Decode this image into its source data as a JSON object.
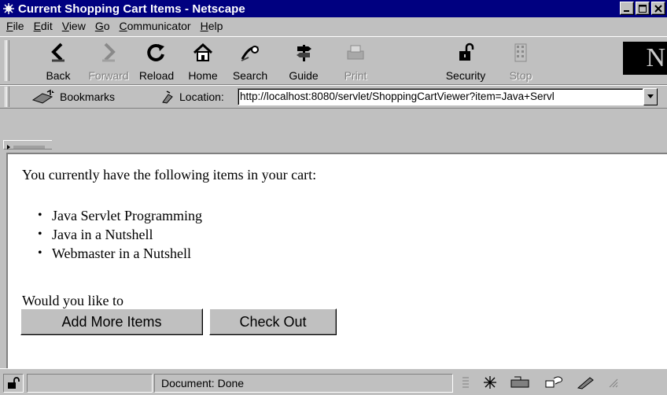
{
  "window": {
    "title": "Current Shopping Cart Items - Netscape"
  },
  "menubar": {
    "items": [
      {
        "ul": "F",
        "rest": "ile"
      },
      {
        "ul": "E",
        "rest": "dit"
      },
      {
        "ul": "V",
        "rest": "iew"
      },
      {
        "ul": "G",
        "rest": "o"
      },
      {
        "ul": "C",
        "rest": "ommunicator"
      },
      {
        "ul": "H",
        "rest": "elp"
      }
    ]
  },
  "toolbar": {
    "back": "Back",
    "forward": "Forward",
    "reload": "Reload",
    "home": "Home",
    "search": "Search",
    "guide": "Guide",
    "print": "Print",
    "security": "Security",
    "stop": "Stop",
    "logo": "N"
  },
  "location": {
    "bookmarks_label": "Bookmarks",
    "label": "Location:",
    "url": "http://localhost:8080/servlet/ShoppingCartViewer?item=Java+Servl"
  },
  "page": {
    "intro": "You currently have the following items in your cart:",
    "items": [
      "Java Servlet Programming",
      "Java in a Nutshell",
      "Webmaster in a Nutshell"
    ],
    "question": "Would you like to",
    "add_button": "Add More Items",
    "checkout_button": "Check Out"
  },
  "statusbar": {
    "status": "Document: Done"
  },
  "colors": {
    "titlebar": "#000080",
    "chrome": "#c0c0c0",
    "content_bg": "#ffffff"
  }
}
